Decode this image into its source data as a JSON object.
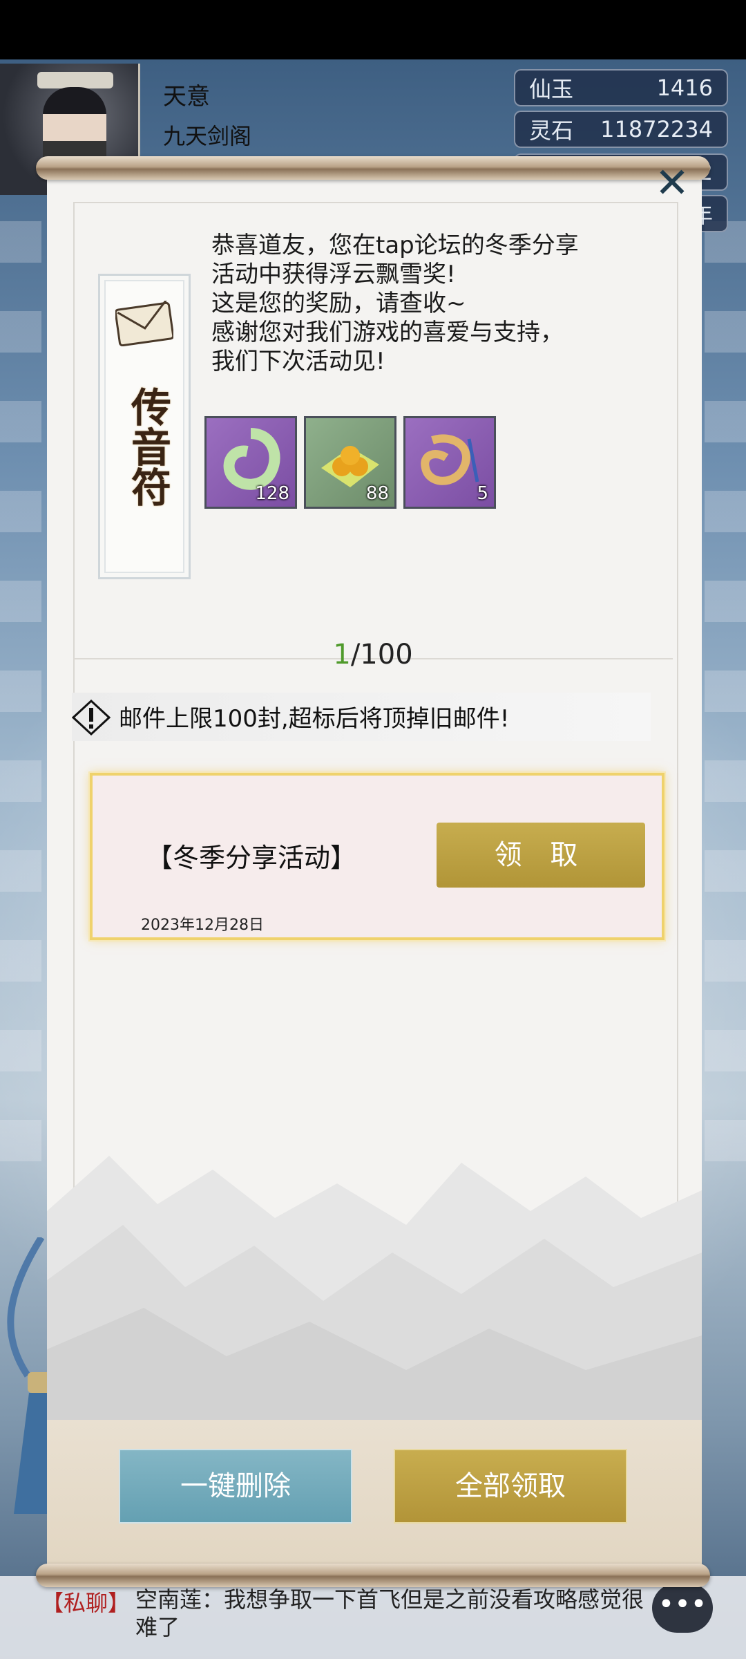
{
  "player": {
    "name": "天意",
    "sect": "九天剑阁"
  },
  "resources": [
    {
      "label": "仙玉",
      "value": "1416"
    },
    {
      "label": "灵石",
      "value": "11872234"
    },
    {
      "label": "",
      "value": "2"
    },
    {
      "label": "",
      "value": "年"
    }
  ],
  "mail": {
    "talisman_text": "传音符",
    "body": "恭喜道友，您在tap论坛的冬季分享\n活动中获得浮云飘雪奖!\n这是您的奖励，请查收~\n感谢您对我们游戏的喜爱与支持，\n我们下次活动见!",
    "items": [
      {
        "icon": "jade-ring-icon",
        "count": "128"
      },
      {
        "icon": "golden-pills-icon",
        "count": "88"
      },
      {
        "icon": "pendant-icon",
        "count": "5"
      }
    ],
    "page_current": "1",
    "page_total": "/100",
    "warning": "邮件上限100封,超标后将顶掉旧邮件!",
    "entry_title": "【冬季分享活动】",
    "entry_date": "2023年12月28日",
    "claim_label": "领 取"
  },
  "footer": {
    "delete_all_label": "一键删除",
    "claim_all_label": "全部领取"
  },
  "chat": {
    "tag": "【私聊】",
    "message": "空南莲：我想争取一下首飞但是之前没看攻略感觉很难了"
  },
  "colors": {
    "accent_gold": "#b8993c",
    "accent_teal": "#6fa7b8",
    "page_current": "#4f9a2b"
  }
}
